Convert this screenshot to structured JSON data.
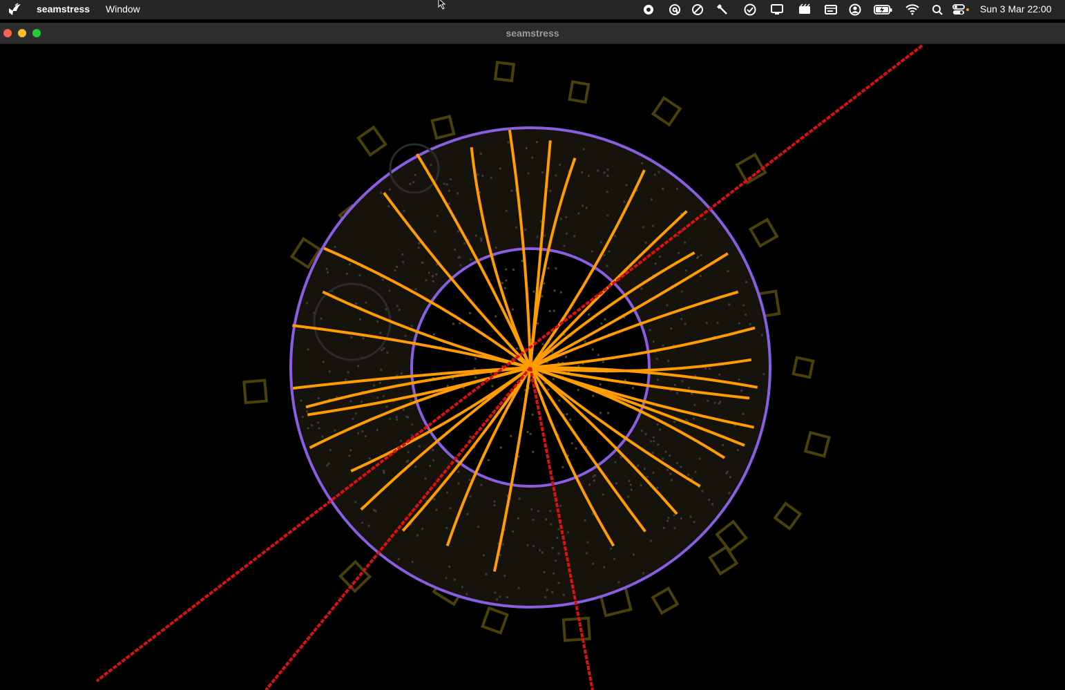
{
  "menubar": {
    "app_name": "seamstress",
    "window_menu": "Window",
    "clock": "Sun 3 Mar  22:00",
    "status_icons": [
      "record-icon",
      "at-icon",
      "do-not-disturb-icon",
      "tool-icon",
      "check-circle-icon",
      "display-icon",
      "clapper-icon",
      "card-icon",
      "user-circle-icon",
      "battery-charging-icon",
      "wifi-icon",
      "search-icon",
      "control-center-icon"
    ]
  },
  "window": {
    "title": "seamstress"
  },
  "colors": {
    "outer_ring": "#8a5ee0",
    "inner_ring": "#8a5ee0",
    "annulus_fill": "#16130d",
    "orange_tracks": "#ff9d00",
    "red_tracks": "#e01010",
    "outer_boxes": "#4a4008",
    "dots": "#3a3a3a"
  }
}
